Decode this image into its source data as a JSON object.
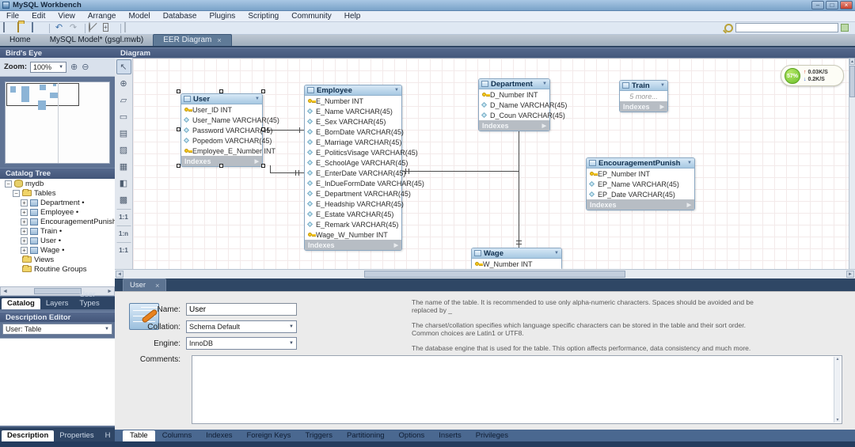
{
  "icons": {
    "close": "×",
    "min": "–",
    "max": "□",
    "dropdown": "▼",
    "play": "▶",
    "left": "◄",
    "right": "►",
    "up": "▲",
    "down": "▼",
    "plus": "+",
    "minus": "−",
    "undo": "↶",
    "redo": "↷",
    "up_arrow": "↑",
    "down_arrow": "↓",
    "diamond": "◆"
  },
  "window": {
    "title": "MySQL Workbench"
  },
  "menu": {
    "items": [
      "File",
      "Edit",
      "View",
      "Arrange",
      "Model",
      "Database",
      "Plugins",
      "Scripting",
      "Community",
      "Help"
    ]
  },
  "model_tabs": {
    "home": "Home",
    "model": "MySQL Model* (gsgl.mwb)",
    "diagram": "EER Diagram"
  },
  "sidebar": {
    "birds_eye": {
      "title": "Bird's Eye",
      "zoom_label": "Zoom:",
      "zoom_value": "100%"
    },
    "catalog": {
      "title": "Catalog Tree",
      "root": "mydb",
      "tables_folder": "Tables",
      "tables": [
        "Department •",
        "Employee •",
        "EncouragementPunish •",
        "Train •",
        "User •",
        "Wage •"
      ],
      "views": "Views",
      "routine_groups": "Routine Groups",
      "tabs": [
        "Catalog",
        "Layers",
        "User Types"
      ]
    },
    "description_editor": {
      "title": "Description Editor",
      "selector": "User: Table",
      "tabs": [
        "Description",
        "Properties",
        "H"
      ]
    }
  },
  "diagram": {
    "header": "Diagram",
    "indexes_label": "Indexes",
    "tools": [
      {
        "name": "select",
        "glyph": "↖"
      },
      {
        "name": "pan",
        "glyph": "⊕"
      },
      {
        "name": "eraser",
        "glyph": "▱"
      },
      {
        "name": "layer",
        "glyph": "▭"
      },
      {
        "name": "note",
        "glyph": "▤"
      },
      {
        "name": "image",
        "glyph": "▨"
      },
      {
        "name": "table",
        "glyph": "▦"
      },
      {
        "name": "view",
        "glyph": "◧"
      },
      {
        "name": "routine-group",
        "glyph": "▩"
      },
      {
        "name": "rel-1-1-non-identifying",
        "glyph": "1:1"
      },
      {
        "name": "rel-1-n-non-identifying",
        "glyph": "1:n"
      },
      {
        "name": "rel-1-1-identifying",
        "glyph": "1:1"
      }
    ],
    "monitor": {
      "percent": "57%",
      "up": "0.03K/S",
      "down": "0.2K/S"
    },
    "tables": [
      {
        "name": "User",
        "columns": [
          {
            "t": "User_ID INT",
            "k": 1
          },
          {
            "t": "User_Name VARCHAR(45)"
          },
          {
            "t": "Password VARCHAR(45)"
          },
          {
            "t": "Popedom VARCHAR(45)"
          },
          {
            "t": "Employee_E_Number INT",
            "k": 1
          }
        ]
      },
      {
        "name": "Employee",
        "columns": [
          {
            "t": "E_Number INT",
            "k": 1
          },
          {
            "t": "E_Name VARCHAR(45)"
          },
          {
            "t": "E_Sex VARCHAR(45)"
          },
          {
            "t": "E_BornDate VARCHAR(45)"
          },
          {
            "t": "E_Marriage VARCHAR(45)"
          },
          {
            "t": "E_PoliticsVisage VARCHAR(45)"
          },
          {
            "t": "E_SchoolAge VARCHAR(45)"
          },
          {
            "t": "E_EnterDate VARCHAR(45)"
          },
          {
            "t": "E_InDueFormDate VARCHAR(45)"
          },
          {
            "t": "E_Department VARCHAR(45)"
          },
          {
            "t": "E_Headship VARCHAR(45)"
          },
          {
            "t": "E_Estate VARCHAR(45)"
          },
          {
            "t": "E_Remark VARCHAR(45)"
          },
          {
            "t": "Wage_W_Number INT",
            "k": 1
          }
        ]
      },
      {
        "name": "Department",
        "columns": [
          {
            "t": "D_Number INT",
            "k": 1
          },
          {
            "t": "D_Name VARCHAR(45)"
          },
          {
            "t": "D_Coun VARCHAR(45)"
          }
        ]
      },
      {
        "name": "Train",
        "columns": [
          {
            "t": "5 more...",
            "more": 1
          }
        ]
      },
      {
        "name": "EncouragementPunish",
        "columns": [
          {
            "t": "EP_Number INT",
            "k": 1
          },
          {
            "t": "EP_Name VARCHAR(45)"
          },
          {
            "t": "EP_Date VARCHAR(45)"
          }
        ]
      },
      {
        "name": "Wage",
        "columns": [
          {
            "t": "W_Number INT",
            "k": 1
          }
        ]
      }
    ]
  },
  "editor": {
    "tab": "User",
    "name_label": "Name:",
    "name_value": "User",
    "collation_label": "Collation:",
    "collation_value": "Schema Default",
    "engine_label": "Engine:",
    "engine_value": "InnoDB",
    "comments_label": "Comments:",
    "help": [
      "The name of the table. It is recommended to use only alpha-numeric characters. Spaces should be avoided and be replaced by _",
      "The charset/collation specifies which language specific characters can be stored in the table and their sort order. Common choices are Latin1 or UTF8.",
      "The database engine that is used for the table. This option affects performance, data consistency and much more."
    ],
    "tabs": [
      "Table",
      "Columns",
      "Indexes",
      "Foreign Keys",
      "Triggers",
      "Partitioning",
      "Options",
      "Inserts",
      "Privileges"
    ]
  }
}
